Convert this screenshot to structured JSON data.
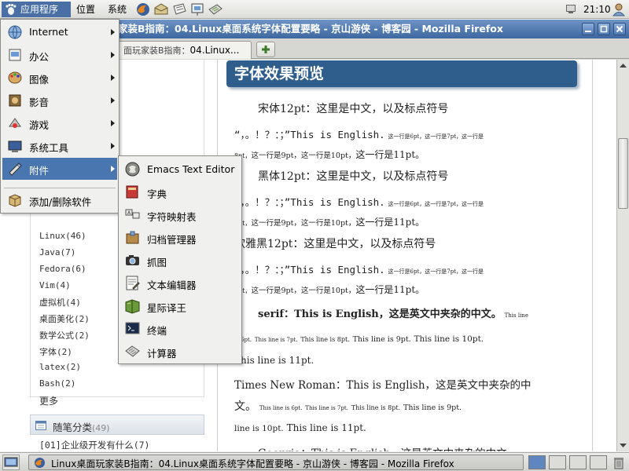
{
  "panel": {
    "apps_label": "应用程序",
    "places_label": "位置",
    "system_label": "系统",
    "clock": "21:10"
  },
  "window": {
    "title": "家装B指南：04.Linux桌面系统字体配置要略 - 京山游侠 - 博客园 - Mozilla Firefox",
    "tab_prefix": "面玩家装B指南：",
    "tab_rest": "04.Linux..."
  },
  "sidebar": {
    "categories": [
      "Linux(46)",
      "Java(7)",
      "Fedora(6)",
      "Vim(4)",
      "虚拟机(4)",
      "桌面美化(2)",
      "数学公式(2)",
      "字体(2)",
      "latex(2)",
      "Bash(2)"
    ],
    "more": "更多",
    "essay_title": "随笔分类",
    "essay_count": "(49)",
    "essay_item": "[01]企业级开发有什么(7)"
  },
  "article": {
    "heading": "字体效果预览",
    "songti_main": "宋体12pt：这里是中文，以及标点符号",
    "heiti_main": "黑体12pt：这里是中文，以及标点符号",
    "yahei_main": "软雅黑12pt：这里是中文，以及标点符号",
    "punct_en": "“，。！？：；”This is English.",
    "zh_small_1": "这一行是6pt，这一行是7pt，这一行是",
    "zh_8pt": "8pt，",
    "zh_small_2": "这一行是9pt，这一行是10pt，",
    "zh_11pt": "这一行是11pt。",
    "serif_main": "serif：This is English，这是英文中夹杂的中文。",
    "serif_6pt_a": "This line",
    "serif_6pt_b": "is 6pt.",
    "serif_7pt": "This line is 7pt.",
    "serif_8pt": "This line is 8pt.",
    "serif_9pt": "This line is 9pt.",
    "serif_10pt": "This line is 10pt.",
    "serif_11pt": "This line is 11pt.",
    "tnr_main": "Times New Roman：This is English，这是英文中夹杂的中",
    "tnr_main_end": "文。",
    "tnr_6pt": "This line is 6pt.",
    "tnr_7pt": "This line is 7pt.",
    "tnr_8pt": "This line is 8pt.",
    "tnr_9pt": "This line is 9pt.",
    "tnr_10pt": "line is 10pt.",
    "tnr_11pt": "This line is 11pt.",
    "georgia_partial": "Georgia：This is English，这是英文中夹杂的中文。"
  },
  "apps_menu": {
    "items": [
      "Internet",
      "办公",
      "图像",
      "影音",
      "游戏",
      "系统工具",
      "附件"
    ],
    "add_remove": "添加/删除软件"
  },
  "accessories_menu": {
    "items": [
      "Emacs Text Editor",
      "字典",
      "字符映射表",
      "归档管理器",
      "抓图",
      "文本编辑器",
      "星际译王",
      "终端",
      "计算器"
    ]
  },
  "taskbar": {
    "task_label": "Linux桌面玩家装B指南：04.Linux桌面系统字体配置要略 - 京山游侠 - 博客园 - Mozilla Firefox"
  },
  "colors": {
    "menu_highlight": "#4a76b0",
    "titlebar": "#3d679f",
    "article_heading": "#2f5d8c"
  }
}
